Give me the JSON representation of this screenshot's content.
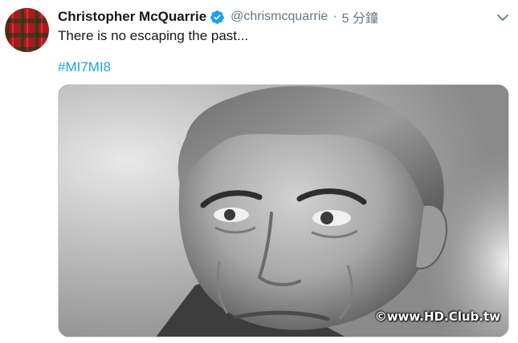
{
  "tweet": {
    "display_name": "Christopher McQuarrie",
    "handle": "@chrismcquarrie",
    "separator": "·",
    "time": "5 分鐘",
    "text": "There is no escaping the past...",
    "hashtag": "#MI7MI8",
    "verified": true,
    "verified_color": "#1da1f2",
    "hashtag_color": "#1da1f2"
  },
  "media": {
    "description_icon": "portrait-photo",
    "watermark": "©www.HD.Club.tw"
  },
  "icons": {
    "avatar": "tartan-avatar",
    "verified": "verified-badge-icon",
    "more": "chevron-down-icon"
  }
}
